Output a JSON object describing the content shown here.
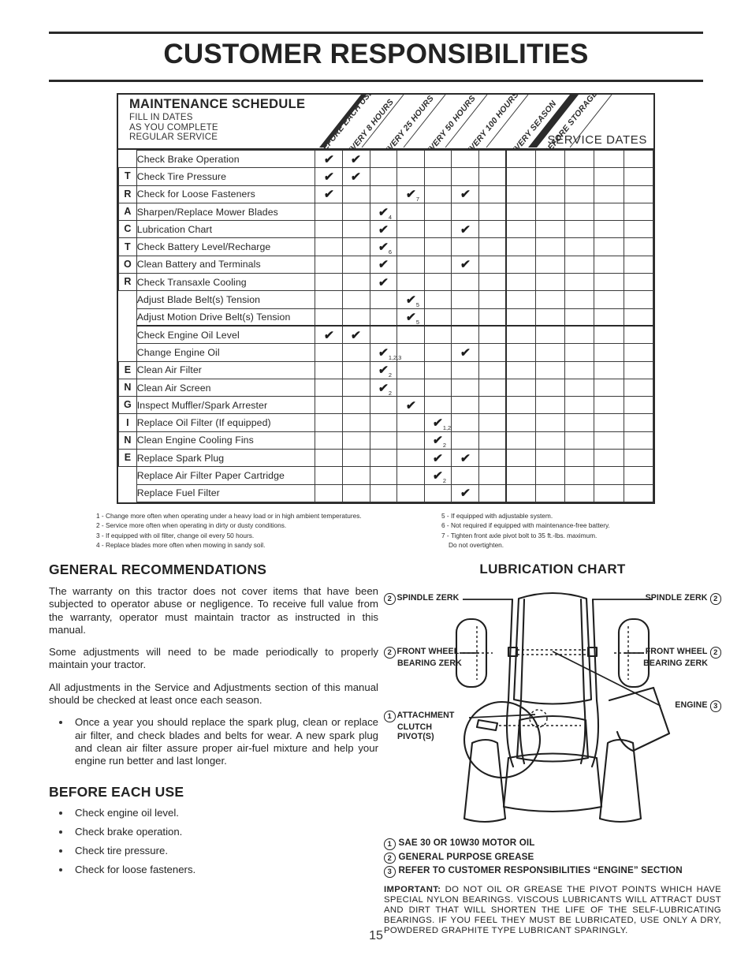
{
  "page": {
    "title": "CUSTOMER RESPONSIBILITIES",
    "number": "15"
  },
  "schedule": {
    "title": "MAINTENANCE SCHEDULE",
    "subtitle_lines": [
      "FILL IN DATES",
      "AS YOU COMPLETE",
      "REGULAR SERVICE"
    ],
    "service_dates_label": "SERVICE DATES",
    "columns": [
      "BEFORE EACH USE",
      "EVERY 8 HOURS",
      "EVERY 25 HOURS",
      "EVERY 50 HOURS",
      "EVERY 100 HOURS",
      "EVERY SEASON",
      "BEFORE STORAGE"
    ],
    "sections": [
      {
        "label": "TRACTOR",
        "rows": [
          {
            "task": "Check Brake Operation",
            "marks": [
              {
                "col": 0
              },
              {
                "col": 1
              }
            ]
          },
          {
            "task": "Check Tire Pressure",
            "marks": [
              {
                "col": 0
              },
              {
                "col": 1
              }
            ]
          },
          {
            "task": "Check for Loose Fasteners",
            "marks": [
              {
                "col": 0
              },
              {
                "col": 3,
                "note": "7"
              },
              {
                "col": 5
              }
            ]
          },
          {
            "task": "Sharpen/Replace Mower Blades",
            "marks": [
              {
                "col": 2,
                "note": "4"
              }
            ]
          },
          {
            "task": "Lubrication Chart",
            "marks": [
              {
                "col": 2
              },
              {
                "col": 5
              }
            ]
          },
          {
            "task": "Check Battery Level/Recharge",
            "marks": [
              {
                "col": 2,
                "note": "6"
              }
            ]
          },
          {
            "task": "Clean Battery and Terminals",
            "marks": [
              {
                "col": 2
              },
              {
                "col": 5
              }
            ]
          },
          {
            "task": "Check Transaxle Cooling",
            "marks": [
              {
                "col": 2
              }
            ]
          },
          {
            "task": "Adjust Blade Belt(s) Tension",
            "marks": [
              {
                "col": 3,
                "note": "5"
              }
            ]
          },
          {
            "task": "Adjust Motion Drive Belt(s) Tension",
            "marks": [
              {
                "col": 3,
                "note": "5"
              }
            ]
          }
        ]
      },
      {
        "label": "ENGINE",
        "rows": [
          {
            "task": "Check Engine Oil Level",
            "marks": [
              {
                "col": 0
              },
              {
                "col": 1
              }
            ]
          },
          {
            "task": "Change Engine Oil",
            "marks": [
              {
                "col": 2,
                "note": "1,2,3"
              },
              {
                "col": 5
              }
            ]
          },
          {
            "task": "Clean Air Filter",
            "marks": [
              {
                "col": 2,
                "note": "2"
              }
            ]
          },
          {
            "task": "Clean Air Screen",
            "marks": [
              {
                "col": 2,
                "note": "2"
              }
            ]
          },
          {
            "task": "Inspect Muffler/Spark Arrester",
            "marks": [
              {
                "col": 3
              }
            ]
          },
          {
            "task": "Replace Oil Filter (If equipped)",
            "marks": [
              {
                "col": 4,
                "note": "1,2"
              }
            ]
          },
          {
            "task": "Clean Engine Cooling Fins",
            "marks": [
              {
                "col": 4,
                "note": "2"
              }
            ]
          },
          {
            "task": "Replace Spark Plug",
            "marks": [
              {
                "col": 4
              },
              {
                "col": 5
              }
            ]
          },
          {
            "task": "Replace Air Filter Paper Cartridge",
            "marks": [
              {
                "col": 4,
                "note": "2"
              }
            ]
          },
          {
            "task": "Replace Fuel Filter",
            "marks": [
              {
                "col": 5
              }
            ]
          }
        ]
      }
    ],
    "footnotes_left": [
      "1 - Change more often when operating under a heavy load or in high ambient temperatures.",
      "2 - Service more often when operating in dirty or dusty conditions.",
      "3 - If equipped with oil filter, change oil every 50 hours.",
      "4 - Replace blades more often when mowing in sandy soil."
    ],
    "footnotes_right": [
      "5 - If equipped with adjustable system.",
      "6 - Not required if equipped with maintenance-free battery.",
      "7 - Tighten front axle pivot bolt to 35 ft.-lbs. maximum."
    ],
    "footnote_right_continuation": "Do not overtighten."
  },
  "general": {
    "heading": "GENERAL RECOMMENDATIONS",
    "paragraphs": [
      "The warranty on this tractor does not cover items that have been subjected to operator abuse or negligence.  To receive full value from the warranty, operator must maintain tractor as instructed in this manual.",
      "Some adjustments will need to be made periodically to properly maintain your tractor.",
      "All adjustments in the Service and Adjustments section of this manual should be checked at least once each season."
    ],
    "bullets": [
      "Once a year you should replace the spark plug, clean or replace air filter, and check blades and belts for wear.  A new spark plug and clean air filter assure proper air-fuel mixture and help your engine run better and last longer."
    ],
    "before_each_use": {
      "heading": "BEFORE EACH USE",
      "items": [
        "Check engine oil level.",
        "Check brake operation.",
        "Check tire pressure.",
        "Check for loose fasteners."
      ]
    }
  },
  "lubrication": {
    "heading": "LUBRICATION CHART",
    "callouts": [
      {
        "id": "spindle-zerk-left",
        "num": "2",
        "text": "SPINDLE ZERK",
        "num_side": "left"
      },
      {
        "id": "spindle-zerk-right",
        "num": "2",
        "text": "SPINDLE ZERK",
        "num_side": "right"
      },
      {
        "id": "front-wheel-bearing-zerk-left",
        "num": "2",
        "text_line1": "FRONT WHEEL",
        "text_line2": "BEARING  ZERK",
        "num_side": "left"
      },
      {
        "id": "front-wheel-bearing-zerk-right",
        "num": "2",
        "text_line1": "FRONT WHEEL",
        "text_line2": "BEARING  ZERK",
        "num_side": "right"
      },
      {
        "id": "engine",
        "num": "3",
        "text": "ENGINE",
        "num_side": "right"
      },
      {
        "id": "attachment-clutch-pivots",
        "num": "1",
        "text_line1": "ATTACHMENT",
        "text_line2": "CLUTCH",
        "text_line3": "PIVOT(S)",
        "num_side": "left"
      }
    ],
    "legend": [
      {
        "num": "1",
        "text": "SAE 30 OR 10W30 MOTOR OIL"
      },
      {
        "num": "2",
        "text": "GENERAL PURPOSE GREASE"
      },
      {
        "num": "3",
        "text": "REFER TO CUSTOMER RESPONSIBILITIES “ENGINE” SECTION"
      }
    ],
    "important_label": "IMPORTANT:",
    "important_text": "DO NOT OIL OR GREASE THE PIVOT POINTS WHICH HAVE SPECIAL NYLON BEARINGS.  VISCOUS LUBRICANTS WILL ATTRACT DUST AND DIRT THAT WILL SHORTEN THE LIFE OF THE SELF-LUBRICATING BEARINGS.  IF YOU FEEL THEY MUST BE LUBRICATED, USE ONLY A DRY, POWDERED GRAPHITE TYPE LUBRICANT SPARINGLY."
  },
  "icons": {
    "check": "✔"
  },
  "colors": {
    "ink": "#232323",
    "rule": "#2b2b2b",
    "grid": "#3a3a3a"
  }
}
